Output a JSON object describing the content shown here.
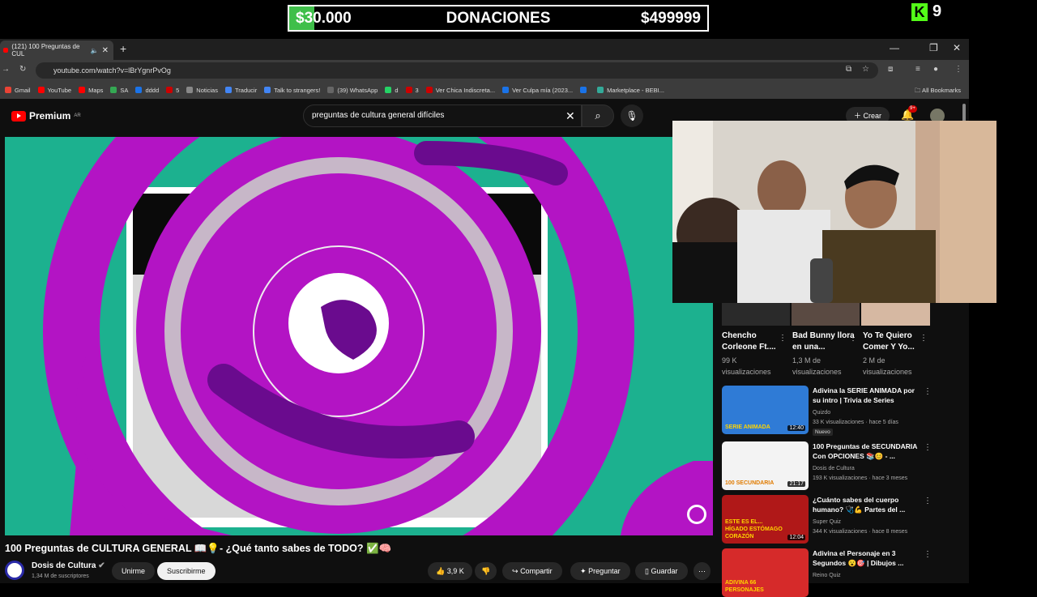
{
  "overlay": {
    "donations": {
      "current": "$30.000",
      "title": "DONACIONES",
      "goal": "$499999",
      "progress": 0.06
    },
    "kick_viewers": "9"
  },
  "browser": {
    "tab_title": "(121) 100 Preguntas de CUL",
    "url": "youtube.com/watch?v=lBrYgnrPvOg",
    "bookmarks": [
      "Gmail",
      "YouTube",
      "Maps",
      "SA",
      "dddd",
      "5",
      "Noticias",
      "Traducir",
      "Talk to strangers!",
      "(39) WhatsApp",
      "d",
      "3",
      "Ver Chica Indiscreta...",
      "Ver Culpa mía (2023...",
      "",
      "Marketplace - BEBI..."
    ],
    "all_bookmarks": "All Bookmarks"
  },
  "youtube": {
    "logo": "Premium",
    "region": "AR",
    "search_query": "preguntas de cultura general difíciles",
    "create_label": "Crear",
    "notif_count": "9+"
  },
  "video": {
    "title": "100 Preguntas de CULTURA GENERAL 📖💡- ¿Qué tanto sabes de TODO? ✅🧠",
    "channel": "Dosis de Cultura",
    "subscribers": "1,34 M de suscriptores",
    "join_label": "Unirme",
    "subscribe_label": "Suscribirme",
    "likes": "3,9 K",
    "share_label": "Compartir",
    "ask_label": "Preguntar",
    "save_label": "Guardar"
  },
  "shorts": [
    {
      "title": "Chencho Corleone Ft....",
      "views": "99 K visualizaciones"
    },
    {
      "title": "Bad Bunny llora en una...",
      "views": "1,3 M de visualizaciones"
    },
    {
      "title": "Yo Te Quiero Comer Y Yo...",
      "views": "2 M de visualizaciones"
    }
  ],
  "sidebar": [
    {
      "title": "Adivina la SERIE ANIMADA por su intro | Trivia de Series",
      "channel": "Quizdo",
      "meta": "33 K visualizaciones · hace 5 días",
      "badge": "Nuevo",
      "duration": "12:40",
      "thumb_text": "SERIE ANIMADA",
      "thumb_color": "#2f7bd6"
    },
    {
      "title": "100 Preguntas de SECUNDARIA Con OPCIONES 📚😊 - ...",
      "channel": "Dosis de Cultura",
      "meta": "193 K visualizaciones · hace 3 meses",
      "duration": "21:17",
      "thumb_text": "100 SECUNDARIA",
      "thumb_color": "#f3f3f3"
    },
    {
      "title": "¿Cuánto sabes del cuerpo humano? 🩺💪 Partes del ...",
      "channel": "Super Quiz",
      "meta": "344 K visualizaciones · hace 8 meses",
      "duration": "12:04",
      "thumb_text": "ESTE ES EL... HÍGADO ESTÓMAGO CORAZÓN",
      "thumb_color": "#b01818"
    },
    {
      "title": "Adivina el Personaje en 3 Segundos 😮🎯 | Dibujos ...",
      "channel": "Reino Quiz",
      "thumb_text": "ADIVINA 66 PERSONAJES",
      "thumb_color": "#d62a2a"
    }
  ],
  "colors": {
    "video_bg": "#1cb18f",
    "magenta": "#b314c4",
    "purple": "#6a0b8e",
    "donation_fill": "#3fbf4a",
    "kick_green": "#53fc18"
  }
}
